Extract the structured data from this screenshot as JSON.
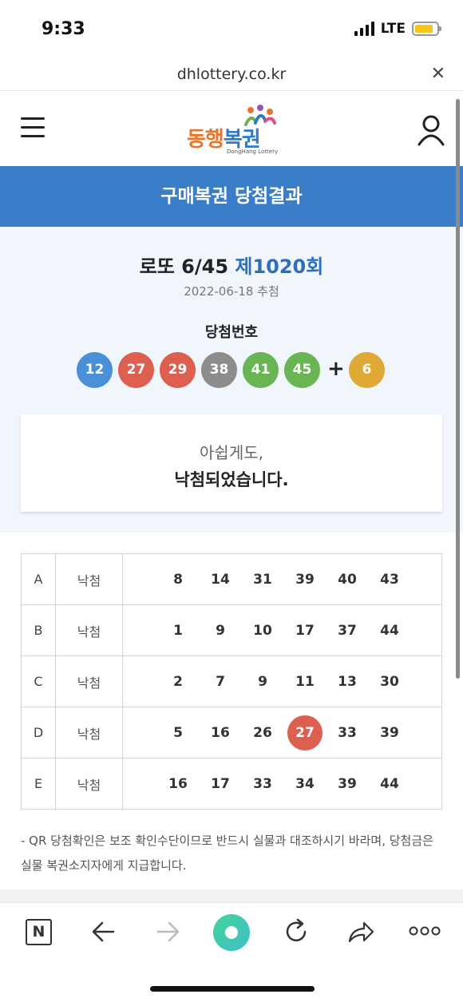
{
  "status": {
    "time": "9:33",
    "network": "LTE",
    "battery_level": 0.85
  },
  "browser": {
    "url": "dhlottery.co.kr"
  },
  "header": {
    "logo_text_orange": "동행",
    "logo_text_blue": "복권",
    "logo_sub": "DongHang Lottery"
  },
  "banner": {
    "title": "구매복권 당첨결과"
  },
  "draw": {
    "game": "로또 6/45 ",
    "round": "제1020회",
    "date": "2022-06-18 추첨",
    "winning_label": "당첨번호",
    "plus": "+",
    "balls": [
      {
        "value": "12",
        "color": "#4a90d9"
      },
      {
        "value": "27",
        "color": "#dc5f4f"
      },
      {
        "value": "29",
        "color": "#dc5f4f"
      },
      {
        "value": "38",
        "color": "#8c8c8c"
      },
      {
        "value": "41",
        "color": "#6ab553"
      },
      {
        "value": "45",
        "color": "#6ab553"
      }
    ],
    "bonus": {
      "value": "6",
      "color": "#e0a935"
    }
  },
  "message": {
    "line1": "아쉽게도,",
    "line2": "낙첨되었습니다."
  },
  "rows": [
    {
      "letter": "A",
      "status": "낙첨",
      "numbers": [
        "8",
        "14",
        "31",
        "39",
        "40",
        "43"
      ],
      "hits": []
    },
    {
      "letter": "B",
      "status": "낙첨",
      "numbers": [
        "1",
        "9",
        "10",
        "17",
        "37",
        "44"
      ],
      "hits": []
    },
    {
      "letter": "C",
      "status": "낙첨",
      "numbers": [
        "2",
        "7",
        "9",
        "11",
        "13",
        "30"
      ],
      "hits": []
    },
    {
      "letter": "D",
      "status": "낙첨",
      "numbers": [
        "5",
        "16",
        "26",
        "27",
        "33",
        "39"
      ],
      "hits": [
        3
      ]
    },
    {
      "letter": "E",
      "status": "낙첨",
      "numbers": [
        "16",
        "17",
        "33",
        "34",
        "39",
        "44"
      ],
      "hits": []
    }
  ],
  "notice": "- QR 당첨확인은 보조 확인수단이므로 반드시 실물과 대조하시기 바라며, 당첨금은 실물 복권소지자에게 지급합니다.",
  "nav": {
    "n_label": "N"
  },
  "colors": {
    "banner": "#3a7dc9",
    "round": "#2e6fba",
    "hit": "#dc5f4f"
  }
}
